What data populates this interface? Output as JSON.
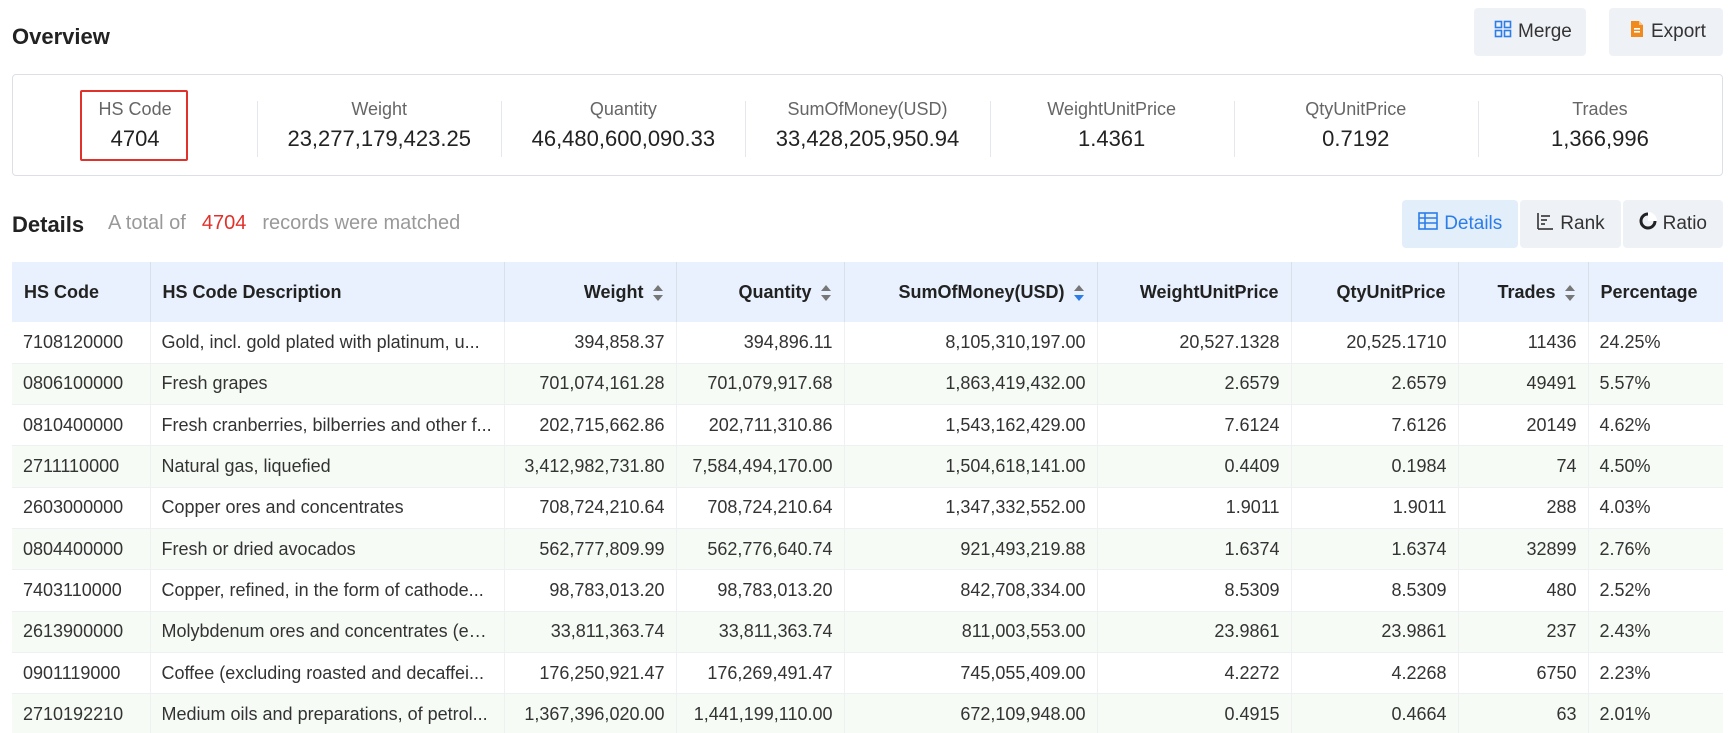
{
  "overview": {
    "title": "Overview",
    "merge_label": "Merge",
    "export_label": "Export"
  },
  "summary": [
    {
      "label": "HS Code",
      "value": "4704"
    },
    {
      "label": "Weight",
      "value": "23,277,179,423.25"
    },
    {
      "label": "Quantity",
      "value": "46,480,600,090.33"
    },
    {
      "label": "SumOfMoney(USD)",
      "value": "33,428,205,950.94"
    },
    {
      "label": "WeightUnitPrice",
      "value": "1.4361"
    },
    {
      "label": "QtyUnitPrice",
      "value": "0.7192"
    },
    {
      "label": "Trades",
      "value": "1,366,996"
    }
  ],
  "details": {
    "title": "Details",
    "info_prefix": "A total of",
    "info_count": "4704",
    "info_suffix": "records were matched",
    "tabs": [
      "Details",
      "Rank",
      "Ratio"
    ]
  },
  "table": {
    "columns": [
      "HS Code",
      "HS Code Description",
      "Weight",
      "Quantity",
      "SumOfMoney(USD)",
      "WeightUnitPrice",
      "QtyUnitPrice",
      "Trades",
      "Percentage"
    ],
    "rows": [
      [
        "7108120000",
        "Gold, incl. gold plated with platinum, u...",
        "394,858.37",
        "394,896.11",
        "8,105,310,197.00",
        "20,527.1328",
        "20,525.1710",
        "11436",
        "24.25%"
      ],
      [
        "0806100000",
        "Fresh grapes",
        "701,074,161.28",
        "701,079,917.68",
        "1,863,419,432.00",
        "2.6579",
        "2.6579",
        "49491",
        "5.57%"
      ],
      [
        "0810400000",
        "Fresh cranberries, bilberries and other f...",
        "202,715,662.86",
        "202,711,310.86",
        "1,543,162,429.00",
        "7.6124",
        "7.6126",
        "20149",
        "4.62%"
      ],
      [
        "2711110000",
        "Natural gas, liquefied",
        "3,412,982,731.80",
        "7,584,494,170.00",
        "1,504,618,141.00",
        "0.4409",
        "0.1984",
        "74",
        "4.50%"
      ],
      [
        "2603000000",
        "Copper ores and concentrates",
        "708,724,210.64",
        "708,724,210.64",
        "1,347,332,552.00",
        "1.9011",
        "1.9011",
        "288",
        "4.03%"
      ],
      [
        "0804400000",
        "Fresh or dried avocados",
        "562,777,809.99",
        "562,776,640.74",
        "921,493,219.88",
        "1.6374",
        "1.6374",
        "32899",
        "2.76%"
      ],
      [
        "7403110000",
        "Copper, refined, in the form of cathode...",
        "98,783,013.20",
        "98,783,013.20",
        "842,708,334.00",
        "8.5309",
        "8.5309",
        "480",
        "2.52%"
      ],
      [
        "2613900000",
        "Molybdenum ores and concentrates (ex...",
        "33,811,363.74",
        "33,811,363.74",
        "811,003,553.00",
        "23.9861",
        "23.9861",
        "237",
        "2.43%"
      ],
      [
        "0901119000",
        "Coffee (excluding roasted and decaffei...",
        "176,250,921.47",
        "176,269,491.47",
        "745,055,409.00",
        "4.2272",
        "4.2268",
        "6750",
        "2.23%"
      ],
      [
        "2710192210",
        "Medium oils and preparations, of petrol...",
        "1,367,396,020.00",
        "1,441,199,110.00",
        "672,109,948.00",
        "0.4915",
        "0.4664",
        "63",
        "2.01%"
      ]
    ]
  },
  "colors": {
    "accent": "#2b7de9",
    "highlight": "#e0312b",
    "header_bg": "#e8f1fd",
    "stripe": "#f6fbf5"
  }
}
